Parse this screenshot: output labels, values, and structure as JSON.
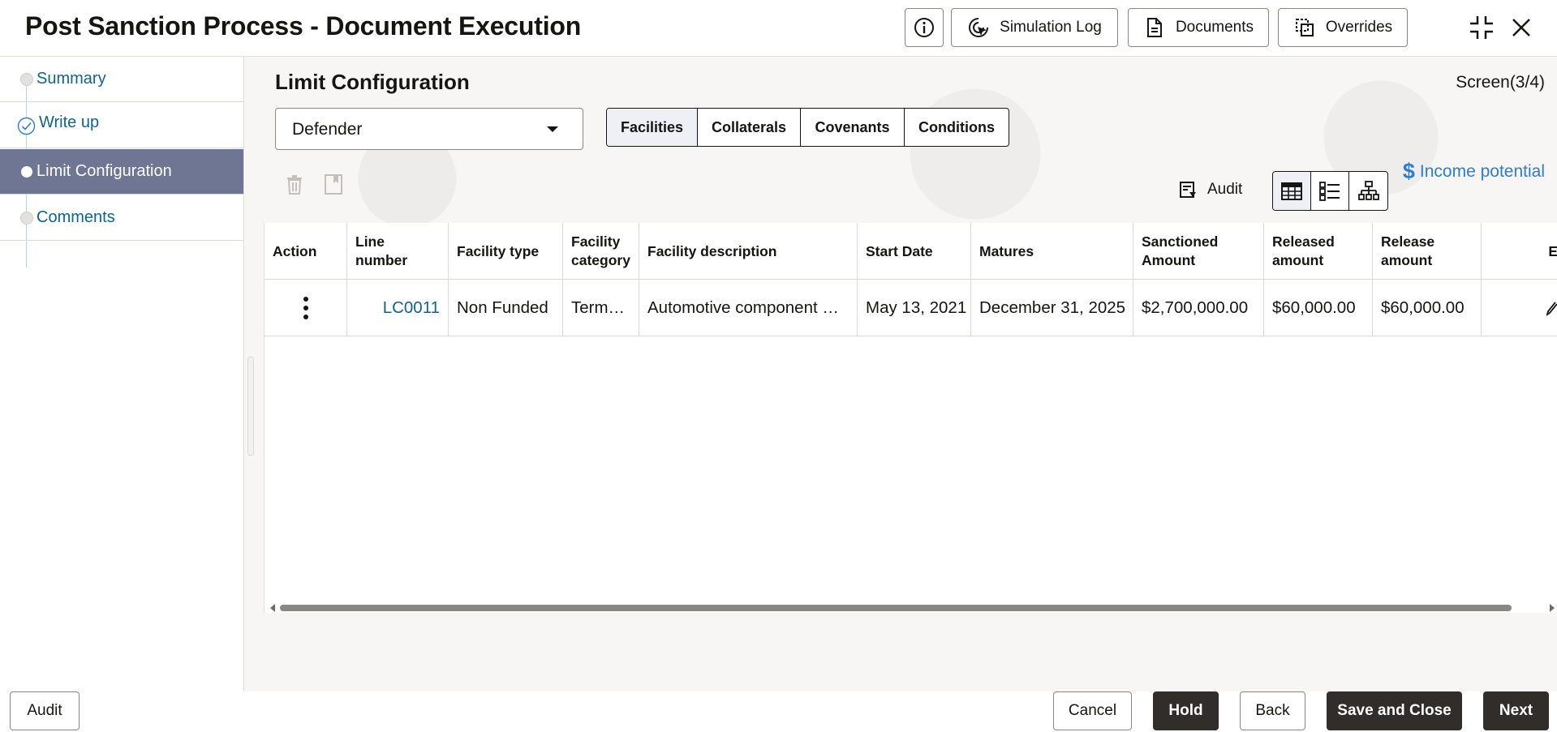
{
  "header": {
    "title": "Post Sanction Process - Document Execution",
    "simulation_log": "Simulation Log",
    "documents": "Documents",
    "overrides": "Overrides"
  },
  "sidebar": {
    "items": [
      {
        "label": "Summary",
        "state": "pending"
      },
      {
        "label": "Write up",
        "state": "done"
      },
      {
        "label": "Limit Configuration",
        "state": "active"
      },
      {
        "label": "Comments",
        "state": "pending"
      }
    ]
  },
  "main": {
    "section_title": "Limit Configuration",
    "screen_indicator": "Screen(3/4)",
    "customer_select": {
      "value": "Defender"
    },
    "tabs": [
      {
        "label": "Facilities",
        "selected": true
      },
      {
        "label": "Collaterals",
        "selected": false
      },
      {
        "label": "Covenants",
        "selected": false
      },
      {
        "label": "Conditions",
        "selected": false
      }
    ],
    "income_potential": "Income potential",
    "income_symbol": "$",
    "audit_label": "Audit"
  },
  "table": {
    "columns": [
      {
        "line1": "Action",
        "line2": ""
      },
      {
        "line1": "Line",
        "line2": "number"
      },
      {
        "line1": "Facility type",
        "line2": ""
      },
      {
        "line1": "Facility",
        "line2": "category"
      },
      {
        "line1": "Facility description",
        "line2": ""
      },
      {
        "line1": "Start Date",
        "line2": ""
      },
      {
        "line1": "Matures",
        "line2": ""
      },
      {
        "line1": "Sanctioned",
        "line2": "Amount"
      },
      {
        "line1": "Released",
        "line2": "amount"
      },
      {
        "line1": "Release",
        "line2": "amount"
      },
      {
        "line1": "E",
        "line2": ""
      }
    ],
    "rows": [
      {
        "line_number": "LC0011",
        "facility_type": "Non Funded",
        "facility_category": "Term…",
        "facility_description": "Automotive component …",
        "start_date": "May 13, 2021",
        "matures": "December 31, 2025",
        "sanctioned_amount": "$2,700,000.00",
        "released_amount": "$60,000.00",
        "release_amount": "$60,000.00"
      }
    ]
  },
  "footer": {
    "audit": "Audit",
    "cancel": "Cancel",
    "hold": "Hold",
    "back": "Back",
    "save_and_close": "Save and Close",
    "next": "Next"
  },
  "colors": {
    "link": "#11638f",
    "active_step_bg": "#6e7693",
    "dark_button": "#312d2a",
    "income_link": "#2d7dd2"
  }
}
